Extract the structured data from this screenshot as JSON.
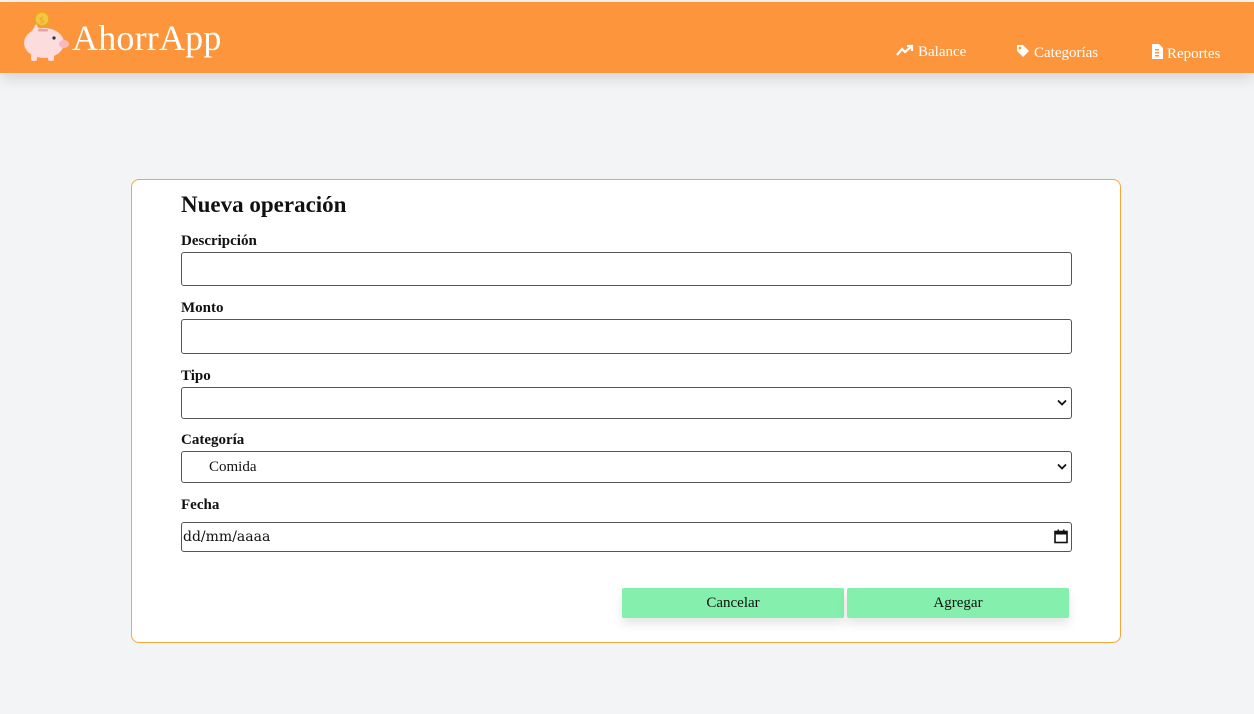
{
  "app": {
    "title": "AhorrApp"
  },
  "nav": {
    "items": [
      {
        "label": "Balance",
        "icon": "trending-up-icon"
      },
      {
        "label": "Categorías",
        "icon": "tag-icon"
      },
      {
        "label": "Reportes",
        "icon": "file-icon"
      }
    ]
  },
  "form": {
    "title": "Nueva operación",
    "description": {
      "label": "Descripción",
      "value": ""
    },
    "amount": {
      "label": "Monto",
      "value": ""
    },
    "type": {
      "label": "Tipo",
      "selected": ""
    },
    "category": {
      "label": "Categoría",
      "selected": "Comida"
    },
    "date": {
      "label": "Fecha",
      "value": "dd/mm/aaaa"
    },
    "cancel_label": "Cancelar",
    "submit_label": "Agregar"
  },
  "colors": {
    "navbar": "#fd953c",
    "card_border": "#f3a93c",
    "button": "#85efad",
    "background": "#f3f4f6"
  }
}
